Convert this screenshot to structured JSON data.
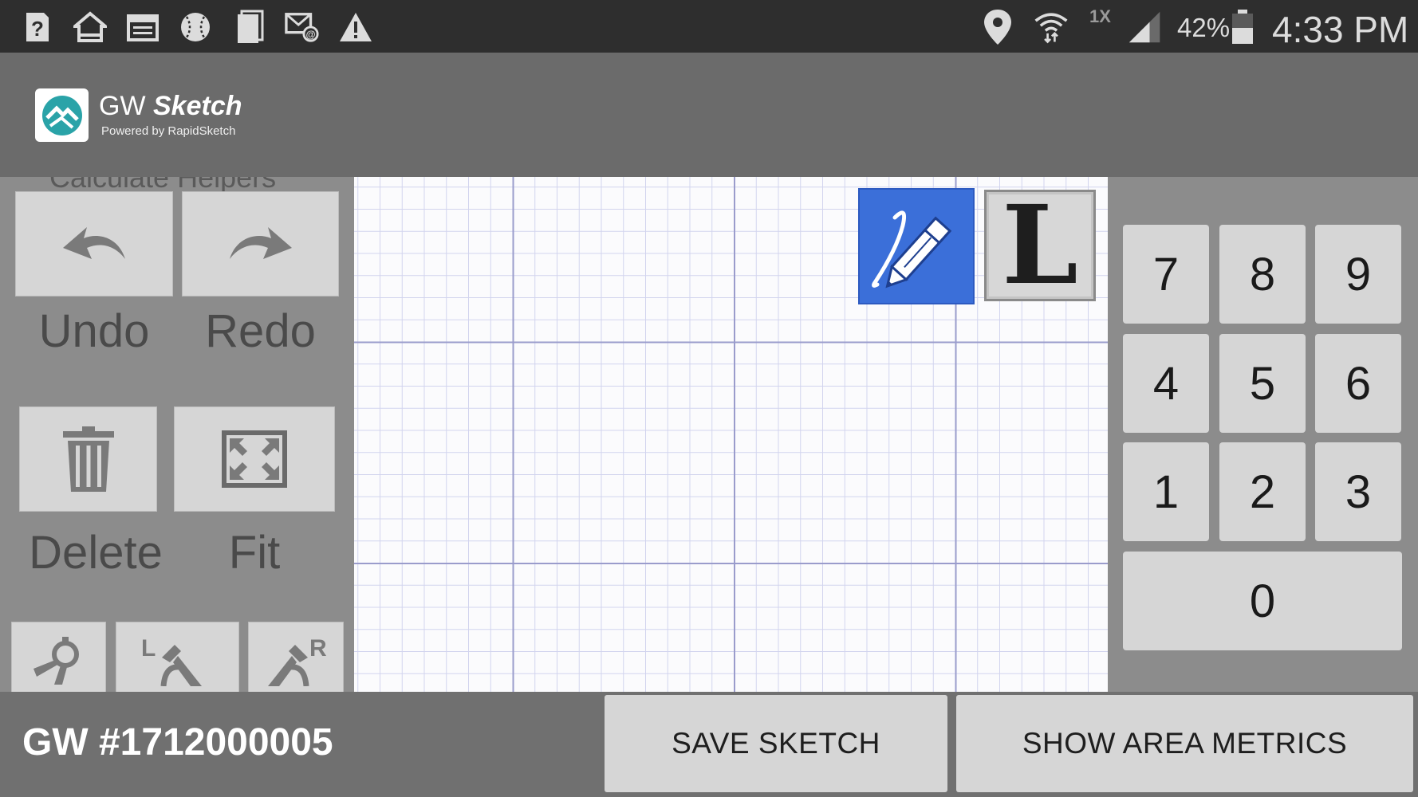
{
  "status_bar": {
    "left_icons": [
      "help-icon",
      "home-icon",
      "calendar-icon",
      "baseball-icon",
      "document-icon",
      "email-notification-icon",
      "warning-icon"
    ],
    "network_label": "1X",
    "battery_percent": "42%",
    "time": "4:33 PM"
  },
  "header": {
    "app_name_prefix": "GW",
    "app_name_bold": "Sketch",
    "app_subtitle": "Powered by RapidSketch"
  },
  "left_panel": {
    "cut_off_label": "Calculate Helpers",
    "undo_label": "Undo",
    "redo_label": "Redo",
    "delete_label": "Delete",
    "fit_label": "Fit"
  },
  "canvas": {
    "draw_mode_icon": "pencil-icon",
    "line_mode_label": "L"
  },
  "keypad": {
    "keys": [
      "7",
      "8",
      "9",
      "4",
      "5",
      "6",
      "1",
      "2",
      "3",
      "0"
    ]
  },
  "bottom_bar": {
    "gw_number": "GW #1712000005",
    "save_label": "SAVE SKETCH",
    "metrics_label": "SHOW AREA METRICS"
  },
  "colors": {
    "active_tool": "#3b6fd9",
    "panel_gray": "#8c8c8c",
    "header_gray": "#6b6b6b",
    "status_bar": "#2e2e2e"
  }
}
